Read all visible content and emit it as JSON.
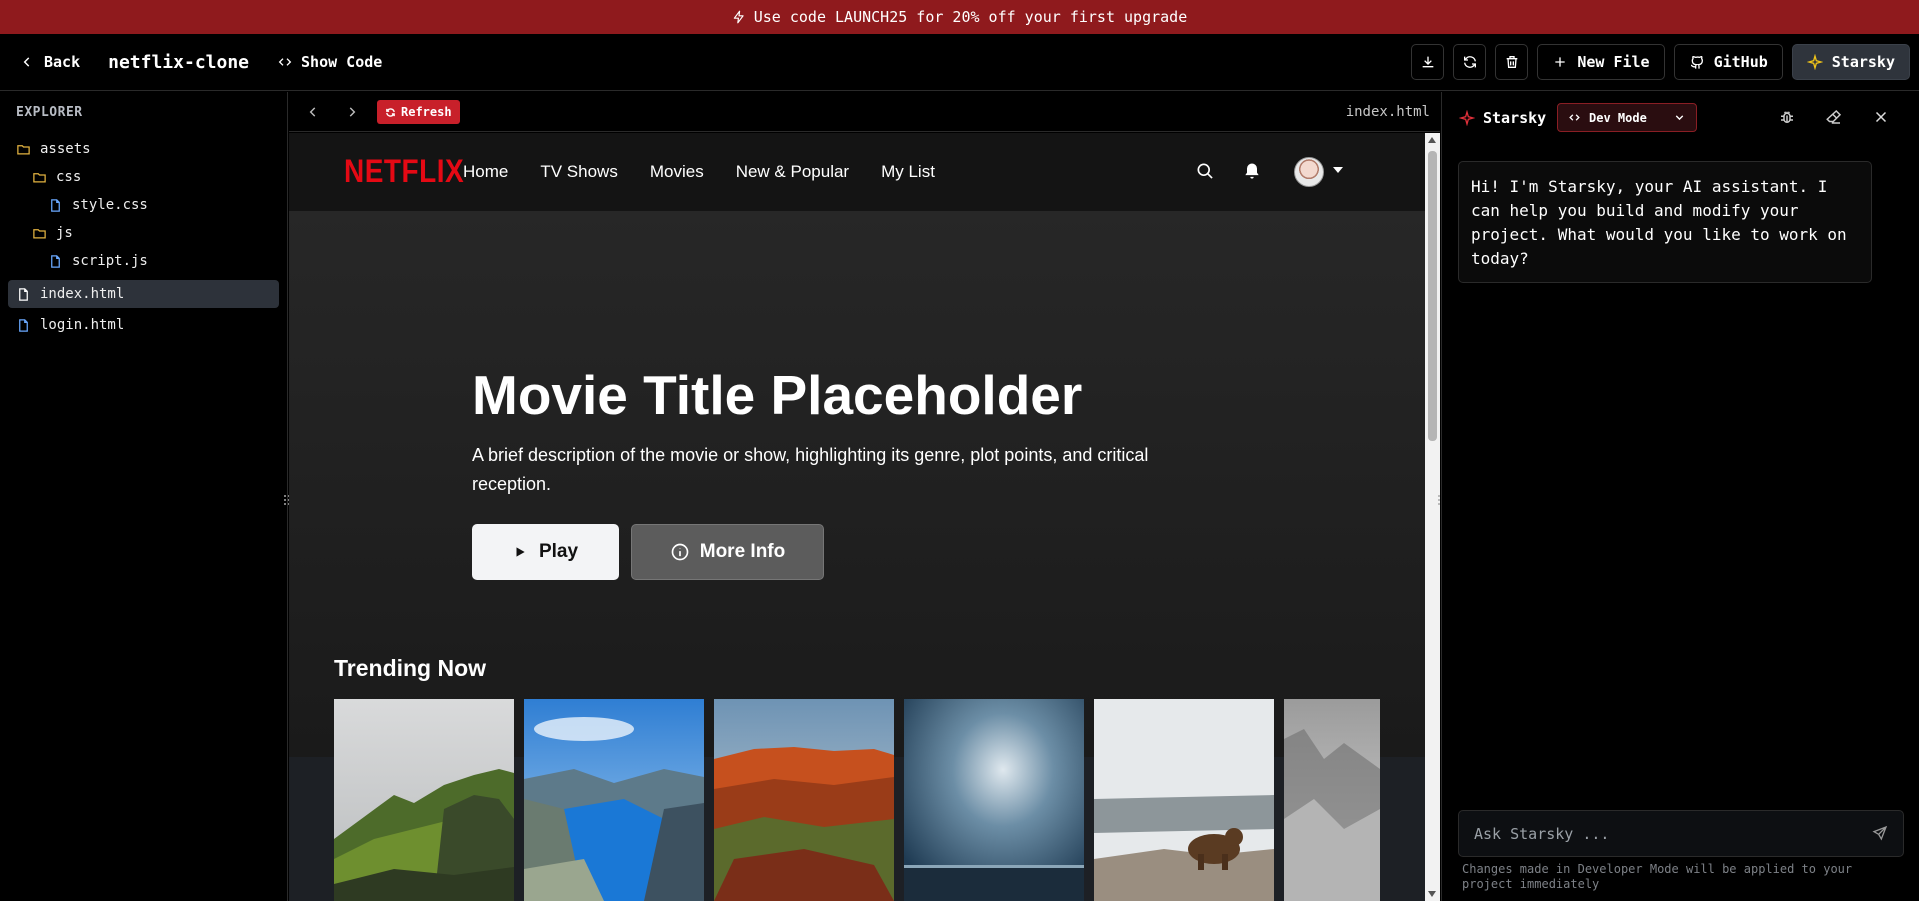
{
  "promo": {
    "text": "Use code LAUNCH25 for 20% off your first upgrade"
  },
  "topbar": {
    "back_label": "Back",
    "project_name": "netflix-clone",
    "show_code_label": "Show Code",
    "new_file_label": "New File",
    "github_label": "GitHub",
    "starsky_label": "Starsky"
  },
  "explorer": {
    "title": "EXPLORER",
    "items": [
      {
        "label": "assets",
        "kind": "folder"
      },
      {
        "label": "css",
        "kind": "folder"
      },
      {
        "label": "style.css",
        "kind": "file"
      },
      {
        "label": "js",
        "kind": "folder"
      },
      {
        "label": "script.js",
        "kind": "file"
      },
      {
        "label": "index.html",
        "kind": "file",
        "active": true
      },
      {
        "label": "login.html",
        "kind": "file"
      }
    ]
  },
  "preview": {
    "refresh_label": "Refresh",
    "file_label": "index.html"
  },
  "site": {
    "logo": "NETFLIX",
    "nav_links": [
      "Home",
      "TV Shows",
      "Movies",
      "New & Popular",
      "My List"
    ],
    "hero_title": "Movie Title Placeholder",
    "hero_description": "A brief description of the movie or show, highlighting its genre, plot points, and critical reception.",
    "play_label": "Play",
    "more_info_label": "More Info",
    "trending_title": "Trending Now",
    "brand_color": "#e50914"
  },
  "chat": {
    "title": "Starsky",
    "mode_label": "Dev Mode",
    "greeting": "Hi! I'm Starsky, your AI assistant. I can help you build and modify your project. What would you like to work on today?",
    "input_placeholder": "Ask Starsky ...",
    "footnote": "Changes made in Developer Mode will be applied to your project immediately"
  },
  "colors": {
    "promo_bg": "#8f1a1d",
    "accent_red": "#c8202a"
  }
}
